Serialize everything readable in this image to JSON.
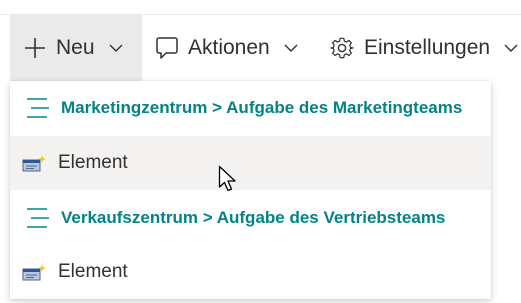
{
  "toolbar": {
    "new_label": "Neu",
    "actions_label": "Aktionen",
    "settings_label": "Einstellungen"
  },
  "menu": {
    "group1_title": "Marketingzentrum > Aufgabe des Marketingteams",
    "group1_item": "Element",
    "group2_title": "Verkaufszentrum > Aufgabe des Vertriebsteams",
    "group2_item": "Element"
  },
  "colors": {
    "accent": "#038387",
    "hover": "#f3f2f1",
    "new_button_bg": "#eaeaea"
  },
  "icons": [
    "plus-icon",
    "chevron-down-icon",
    "chat-icon",
    "gear-icon",
    "list-icon",
    "element-icon",
    "mouse-cursor"
  ]
}
